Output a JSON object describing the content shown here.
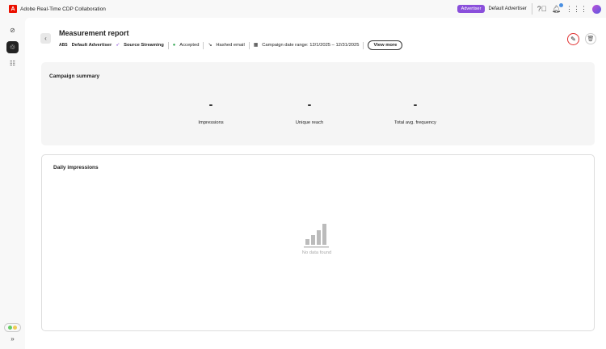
{
  "app": {
    "title": "Adobe Real-Time CDP Collaboration",
    "role_badge": "Advertiser",
    "account": "Default Advertiser"
  },
  "report": {
    "title": "Measurement report",
    "advertiser": "Default Advertiser",
    "advertiser_logo": "ABS",
    "source": "Source Streaming",
    "status": "Accepted",
    "match_key": "Hashed email",
    "date_range": "Campaign date range: 12/1/2025 – 12/31/2025",
    "view_more": "View more"
  },
  "summary": {
    "title": "Campaign summary",
    "metrics": [
      {
        "value": "-",
        "label": "Impressions"
      },
      {
        "value": "-",
        "label": "Unique reach"
      },
      {
        "value": "-",
        "label": "Total avg. frequency"
      }
    ]
  },
  "daily": {
    "title": "Daily impressions",
    "empty": "No data found"
  },
  "colors": {
    "accent": "#8a4fdb",
    "status": "#2da44e",
    "edit_ring": "#e03030"
  }
}
